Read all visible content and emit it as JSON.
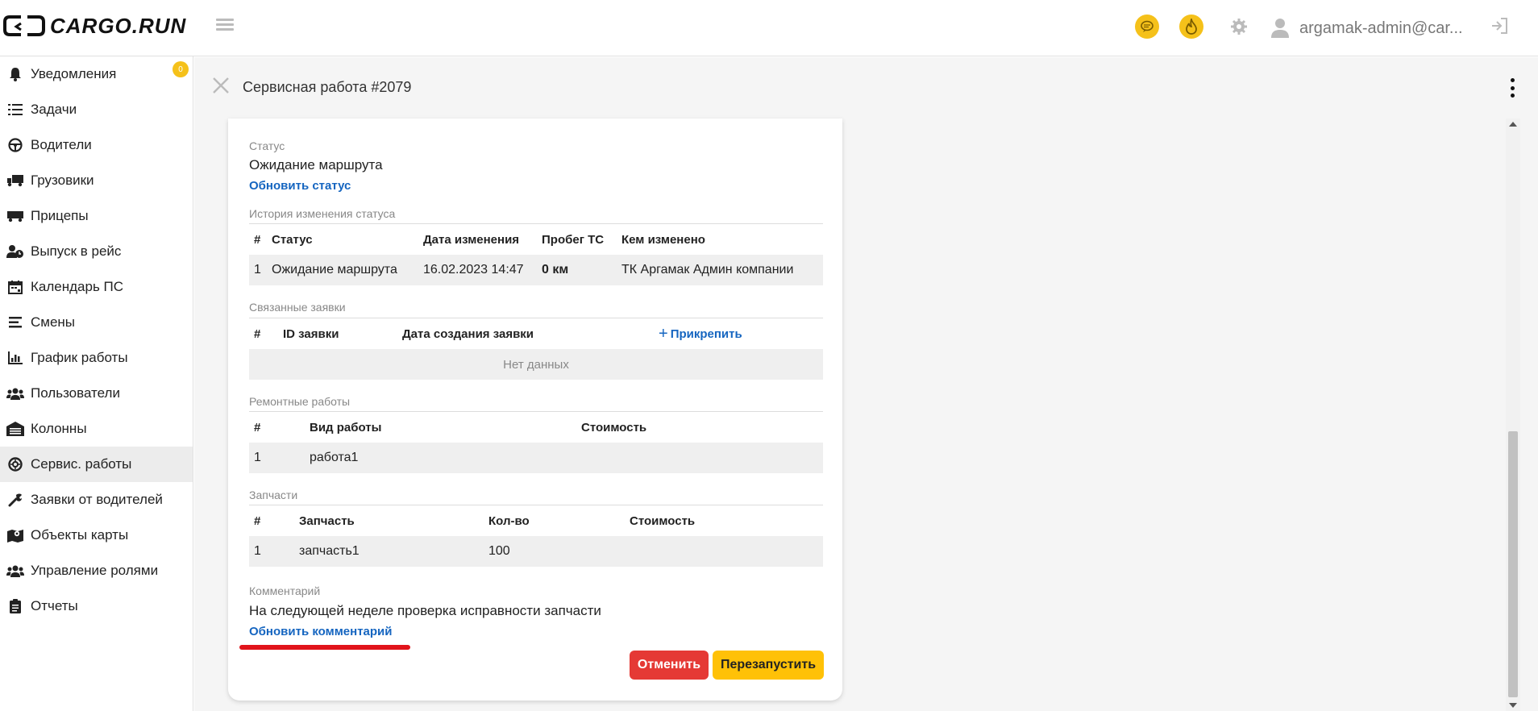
{
  "app": {
    "logo_text": "CARGO.RUN"
  },
  "header": {
    "user_email": "argamak-admin@car...",
    "chat_color": "#f5c11a",
    "fire_color": "#f5c11a"
  },
  "sidebar": {
    "notifications_badge": "0",
    "items": [
      {
        "label": "Уведомления",
        "icon": "bell-icon"
      },
      {
        "label": "Задачи",
        "icon": "tasks-list-icon"
      },
      {
        "label": "Водители",
        "icon": "steering-wheel-icon"
      },
      {
        "label": "Грузовики",
        "icon": "truck-icon"
      },
      {
        "label": "Прицепы",
        "icon": "trailer-icon"
      },
      {
        "label": "Выпуск в рейс",
        "icon": "user-clock-icon"
      },
      {
        "label": "Календарь ПС",
        "icon": "calendar-icon"
      },
      {
        "label": "Смены",
        "icon": "shifts-icon"
      },
      {
        "label": "График работы",
        "icon": "chart-icon"
      },
      {
        "label": "Пользователи",
        "icon": "users-icon"
      },
      {
        "label": "Колонны",
        "icon": "warehouse-icon"
      },
      {
        "label": "Сервис. работы",
        "icon": "service-wheel-icon"
      },
      {
        "label": "Заявки от водителей",
        "icon": "wrench-icon"
      },
      {
        "label": "Объекты карты",
        "icon": "map-marker-icon"
      },
      {
        "label": "Управление ролями",
        "icon": "roles-icon"
      },
      {
        "label": "Отчеты",
        "icon": "clipboard-icon"
      }
    ],
    "active_item": "Сервис. работы"
  },
  "page": {
    "title": "Сервисная работа #2079"
  },
  "card": {
    "status_label": "Статус",
    "status_value": "Ожидание маршрута",
    "update_status_link": "Обновить статус",
    "history_label": "История изменения статуса",
    "history_columns": [
      "#",
      "Статус",
      "Дата изменения",
      "Пробег ТС",
      "Кем изменено"
    ],
    "history_rows": [
      [
        "1",
        "Ожидание маршрута",
        "16.02.2023 14:47",
        "0 км",
        "ТК Аргамак Админ компании"
      ]
    ],
    "requests_label": "Связанные заявки",
    "requests_columns": [
      "#",
      "ID заявки",
      "Дата создания заявки"
    ],
    "attach_link": "Прикрепить",
    "no_data": "Нет данных",
    "repairs_label": "Ремонтные работы",
    "repairs_columns": [
      "#",
      "Вид работы",
      "Стоимость"
    ],
    "repairs_rows": [
      [
        "1",
        "работа1",
        ""
      ]
    ],
    "parts_label": "Запчасти",
    "parts_columns": [
      "#",
      "Запчасть",
      "Кол-во",
      "Стоимость"
    ],
    "parts_rows": [
      [
        "1",
        "запчасть1",
        "100",
        ""
      ]
    ],
    "comment_label": "Комментарий",
    "comment_value": "На следующей неделе проверка исправности запчасти",
    "update_comment_link": "Обновить комментарий",
    "cancel_button": "Отменить",
    "restart_button": "Перезапустить",
    "highlight_color": "#e1141b"
  }
}
